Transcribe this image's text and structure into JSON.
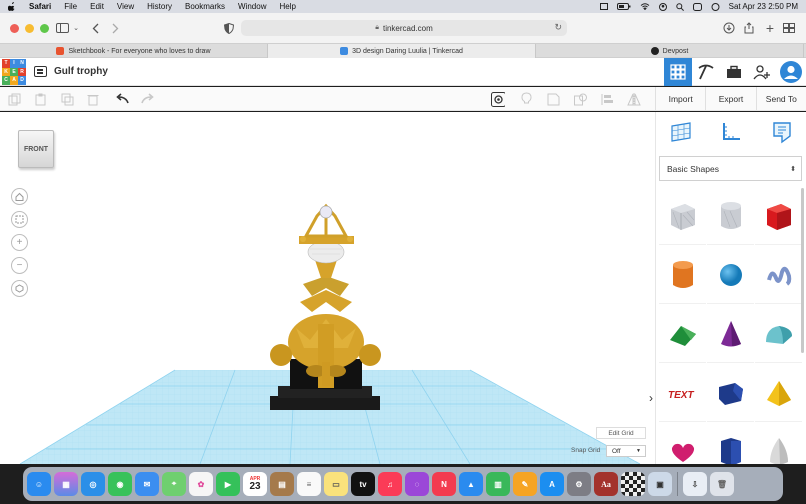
{
  "menubar": {
    "app": "Safari",
    "items": [
      "File",
      "Edit",
      "View",
      "History",
      "Bookmarks",
      "Window",
      "Help"
    ],
    "clock": "Sat Apr 23  2:50 PM"
  },
  "browser": {
    "url": "tinkercad.com",
    "tabs": [
      {
        "label": "Sketchbook - For everyone who loves to draw",
        "color": "#e8532f"
      },
      {
        "label": "3D design Daring Luulia | Tinkercad",
        "color": "#3d8be0"
      },
      {
        "label": "Devpost",
        "color": "#222222"
      }
    ]
  },
  "tinkercad": {
    "logo_letters": [
      "T",
      "I",
      "N",
      "K",
      "E",
      "R",
      "C",
      "A",
      "D"
    ],
    "title": "Gulf trophy",
    "actions": {
      "import": "Import",
      "export": "Export",
      "send": "Send To"
    },
    "viewcube_label": "FRONT",
    "shapes_category": "Basic Shapes",
    "edit_grid": "Edit Grid",
    "snap_grid_label": "Snap Grid",
    "snap_grid_value": "Off",
    "shapes": [
      "box-striped-icon",
      "cylinder-striped-icon",
      "box-icon",
      "cylinder-icon",
      "sphere-icon",
      "scribble-icon",
      "roof-icon",
      "cone-icon",
      "round-roof-icon",
      "text-icon",
      "polygon-icon",
      "pyramid-icon",
      "heart-icon",
      "hexagonal-prism-icon",
      "paraboloid-icon"
    ]
  },
  "dock": {
    "calendar_day": "23",
    "calendar_month": "APR"
  },
  "colors": {
    "accent": "#2f86d6",
    "trophy": "#d6a32b",
    "grid": "#8fd3ef"
  }
}
